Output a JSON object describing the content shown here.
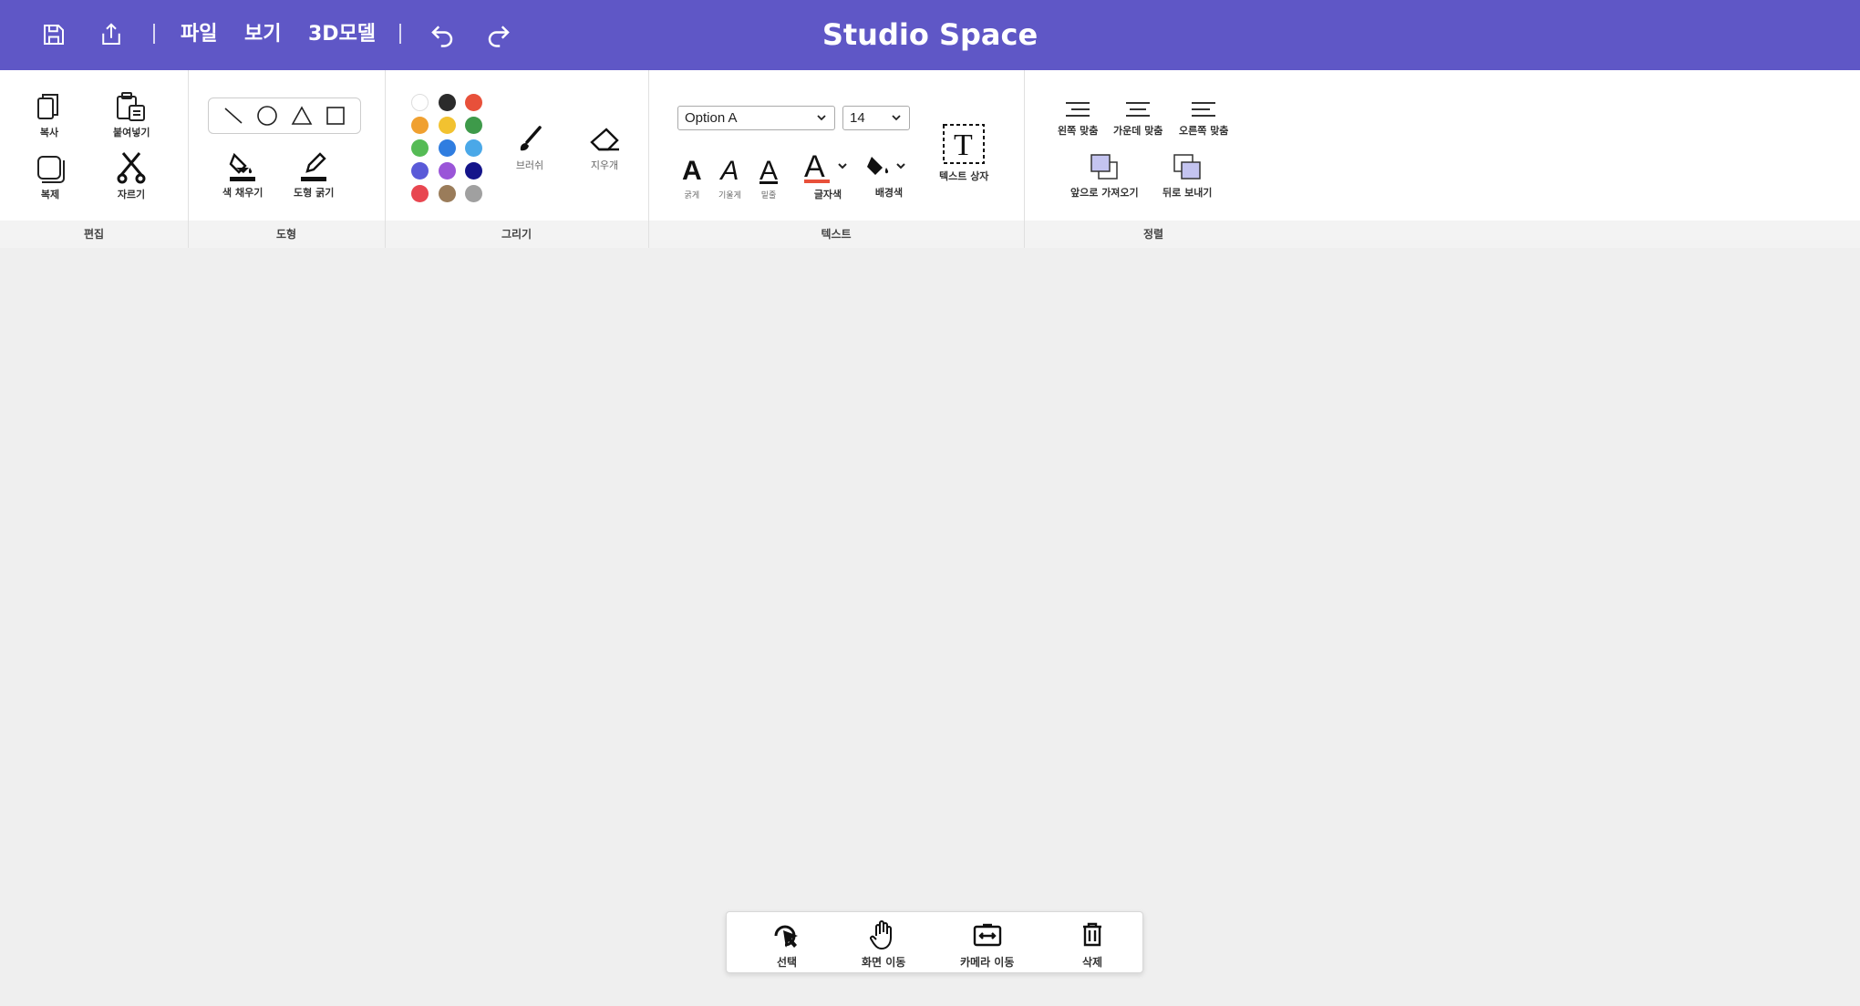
{
  "app": {
    "title": "Studio Space"
  },
  "topbar": {
    "save_icon": "save-icon",
    "share_icon": "share-icon",
    "menus": [
      "파일",
      "보기",
      "3D모델"
    ],
    "undo_icon": "undo-icon",
    "redo_icon": "redo-icon"
  },
  "ribbon": {
    "groups": {
      "edit": "편집",
      "shape": "도형",
      "draw": "그리기",
      "text": "텍스트",
      "arrange": "정렬"
    },
    "edit": {
      "copy": "복사",
      "paste": "붙여넣기",
      "duplicate": "복제",
      "cut": "자르기"
    },
    "shape": {
      "fill": "색 채우기",
      "outline": "도형 굵기"
    },
    "draw": {
      "colors": [
        "#ffffff",
        "#2b2b2b",
        "#e8503a",
        "#f0a030",
        "#f2c230",
        "#3e9a4a",
        "#55bb55",
        "#2f7de0",
        "#4aa8e8",
        "#5a5ad8",
        "#9a55d8",
        "#14148a",
        "#e84650",
        "#9a7c5a",
        "#a0a0a0"
      ],
      "brush": "브러쉬",
      "eraser": "지우개"
    },
    "text": {
      "font": "Option A",
      "size": "14",
      "bold": "굵게",
      "italic": "기울게",
      "underline": "밑줄",
      "font_color": "글자색",
      "bg_color": "배경색",
      "text_box": "텍스트 상자"
    },
    "arrange": {
      "align_left": "왼쪽 맞춤",
      "align_center": "가운데 맞춤",
      "align_right": "오른쪽 맞춤",
      "bring_forward": "앞으로 가져오기",
      "send_backward": "뒤로 보내기"
    }
  },
  "bottom_toolbar": {
    "select": "선택",
    "pan": "화면 이동",
    "camera": "카메라 이동",
    "delete": "삭제"
  },
  "colors": {
    "topbar": "#5f57c6",
    "canvas": "#efefef"
  }
}
